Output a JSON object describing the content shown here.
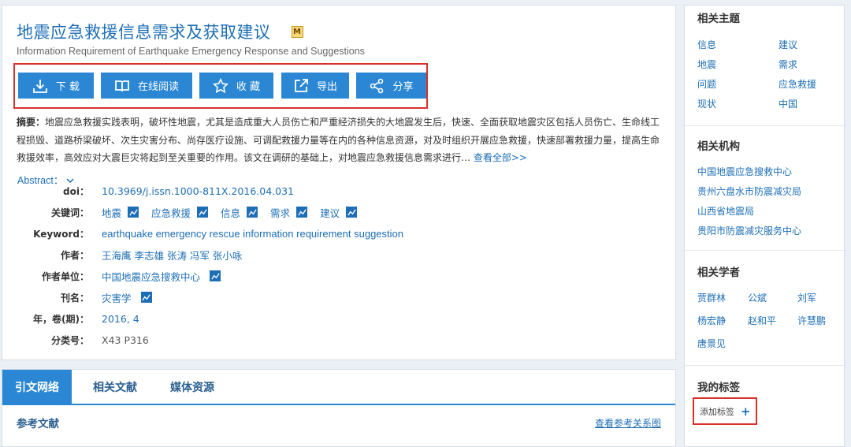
{
  "article": {
    "title_cn": "地震应急救援信息需求及获取建议",
    "badge": "M",
    "title_en": "Information Requirement of Earthquake Emergency Response and Suggestions"
  },
  "actions": [
    {
      "label": "下 载",
      "icon": "download-icon"
    },
    {
      "label": "在线阅读",
      "icon": "book-icon"
    },
    {
      "label": "收 藏",
      "icon": "star-icon"
    },
    {
      "label": "导出",
      "icon": "export-icon"
    },
    {
      "label": "分享",
      "icon": "share-icon"
    }
  ],
  "abstract": {
    "label": "摘要：",
    "text": "地震应急救援实践表明，破坏性地震，尤其是造成重大人员伤亡和严重经济损失的大地震发生后，快速、全面获取地震灾区包括人员伤亡、生命线工程损毁、道路桥梁破坏、次生灾害分布、尚存医疗设施、可调配救援力量等在内的各种信息资源，对及时组织开展应急救援，快速部署救援力量，提高生命救援效率，高效应对大震巨灾将起到至关重要的作用。该文在调研的基础上，对地震应急救援信息需求进行…",
    "more": "查看全部>>",
    "toggle": "Abstract："
  },
  "meta": {
    "doi_label": "doi：",
    "doi": "10.3969/j.issn.1000-811X.2016.04.031",
    "keywords_label": "关键词：",
    "keywords": [
      "地震",
      "应急救援",
      "信息",
      "需求",
      "建议"
    ],
    "keyword_en_label": "Keyword：",
    "keyword_en": "earthquake emergency rescue information requirement suggestion",
    "authors_label": "作者：",
    "authors": "王海鹰 李志雄 张涛 冯军 张小咏",
    "org_label": "作者单位：",
    "org": "中国地震应急搜救中心",
    "journal_label": "刊名：",
    "journal": "灾害学",
    "issue_label": "年，卷(期)：",
    "issue": "2016, 4",
    "class_label": "分类号：",
    "class": "X43 P316"
  },
  "tabs": [
    "引文网络",
    "相关文献",
    "媒体资源"
  ],
  "references": {
    "title": "参考文献",
    "link": "查看参考关系图"
  },
  "sidebar": {
    "topics_title": "相关主题",
    "topics": [
      "信息",
      "建议",
      "地震",
      "需求",
      "问题",
      "应急救援",
      "现状",
      "中国"
    ],
    "orgs_title": "相关机构",
    "orgs": [
      "中国地震应急搜救中心",
      "贵州六盘水市防震减灾局",
      "山西省地震局",
      "贵阳市防震减灾服务中心"
    ],
    "scholars_title": "相关学者",
    "scholars": [
      "贾群林",
      "公斌",
      "刘军",
      "杨宏静",
      "赵和平",
      "许慧鹏",
      "唐景见"
    ],
    "tags_title": "我的标签",
    "add_tag": "添加标签",
    "add_icon": "+"
  },
  "colors": {
    "accent": "#2b87d3",
    "link": "#1d6eb6",
    "highlight": "#d9302c"
  }
}
